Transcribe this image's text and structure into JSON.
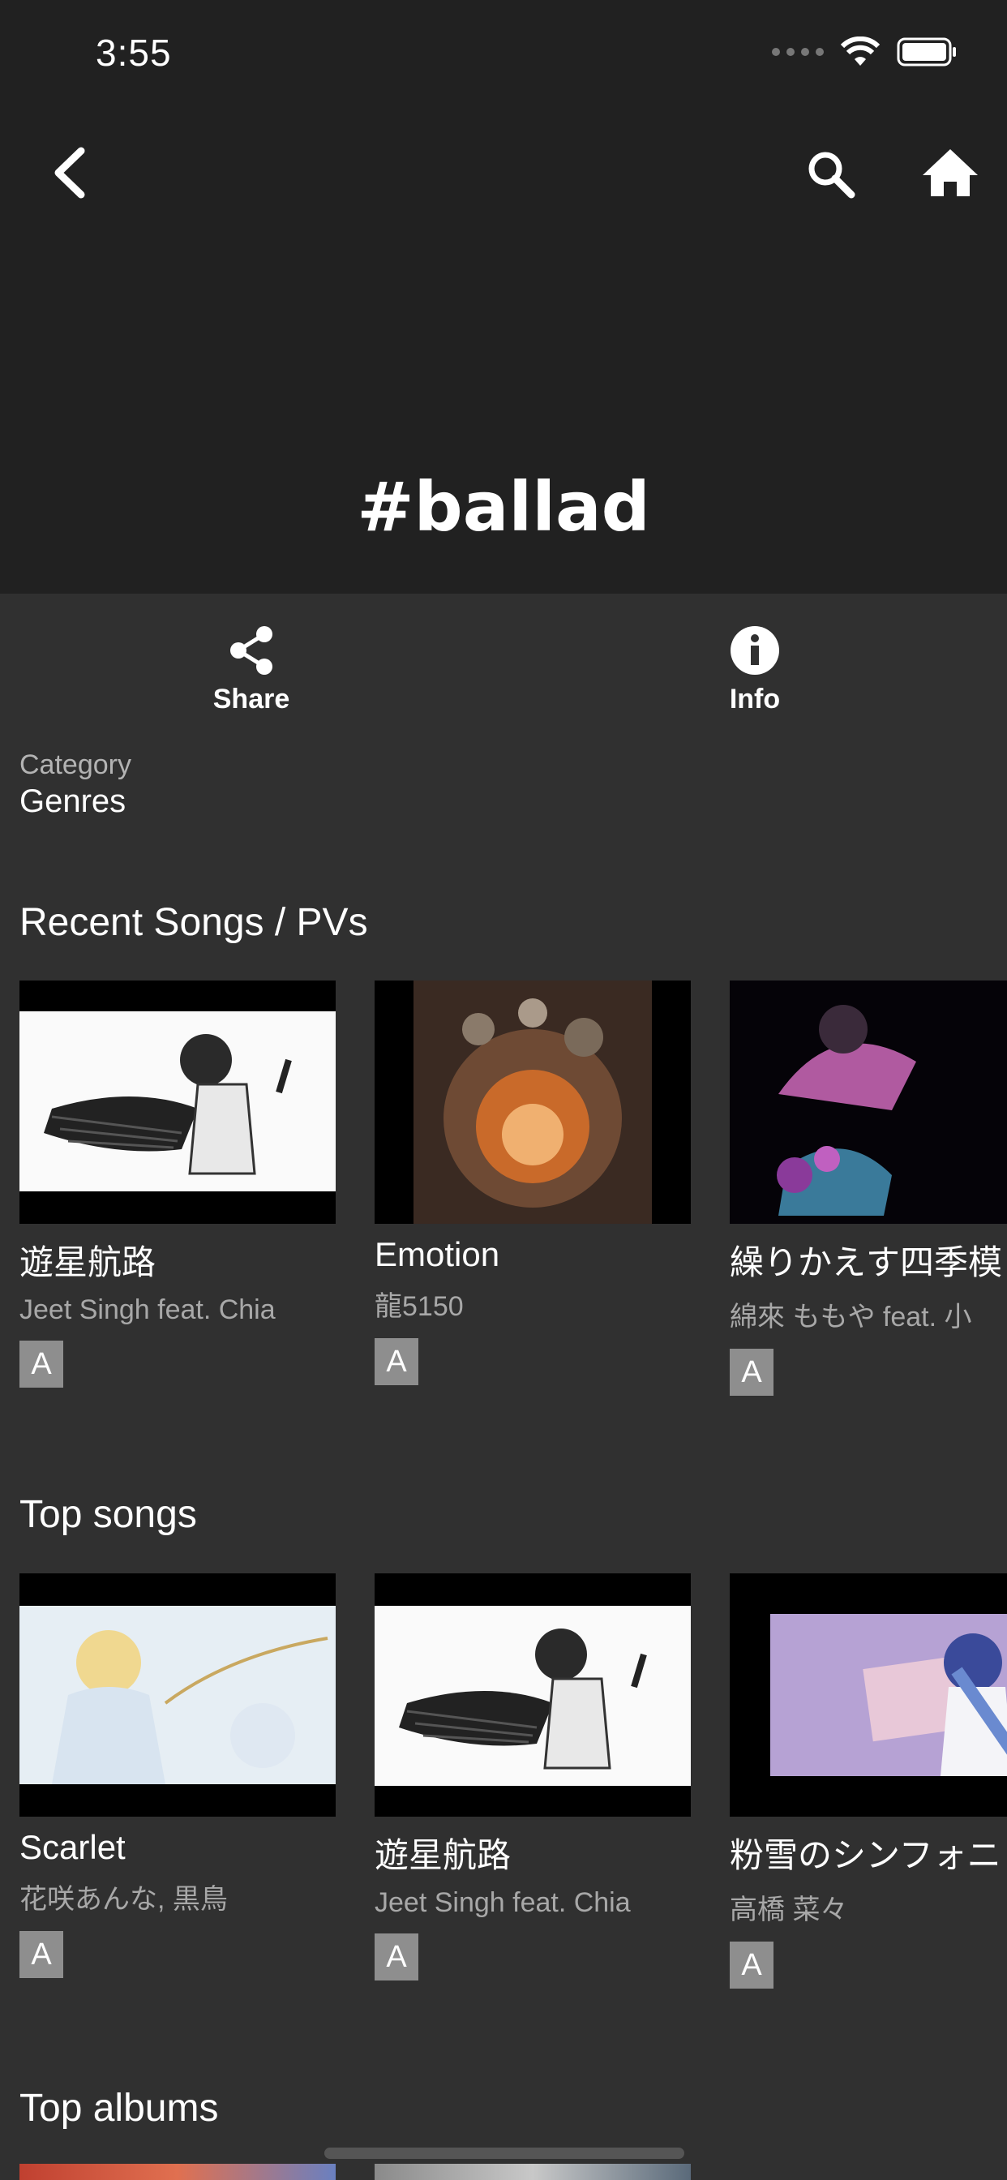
{
  "status_bar": {
    "time": "3:55"
  },
  "header": {
    "title": "#ballad"
  },
  "actions": {
    "share_label": "Share",
    "info_label": "Info"
  },
  "category": {
    "label": "Category",
    "value": "Genres"
  },
  "sections": {
    "recent": {
      "title": "Recent Songs / PVs",
      "items": [
        {
          "title": "遊星航路",
          "artist": "Jeet Singh feat. Chia",
          "badge": "A"
        },
        {
          "title": "Emotion",
          "artist": "龍5150",
          "badge": "A"
        },
        {
          "title": "繰りかえす四季模",
          "artist": "綿來 ももや feat. 小",
          "badge": "A"
        }
      ]
    },
    "top_songs": {
      "title": "Top songs",
      "items": [
        {
          "title": "Scarlet",
          "artist": "花咲あんな, 黒鳥",
          "badge": "A"
        },
        {
          "title": "遊星航路",
          "artist": "Jeet Singh feat. Chia",
          "badge": "A"
        },
        {
          "title": "粉雪のシンフォニ",
          "artist": "高橋 菜々",
          "badge": "A"
        }
      ]
    },
    "top_albums": {
      "title": "Top albums"
    }
  }
}
